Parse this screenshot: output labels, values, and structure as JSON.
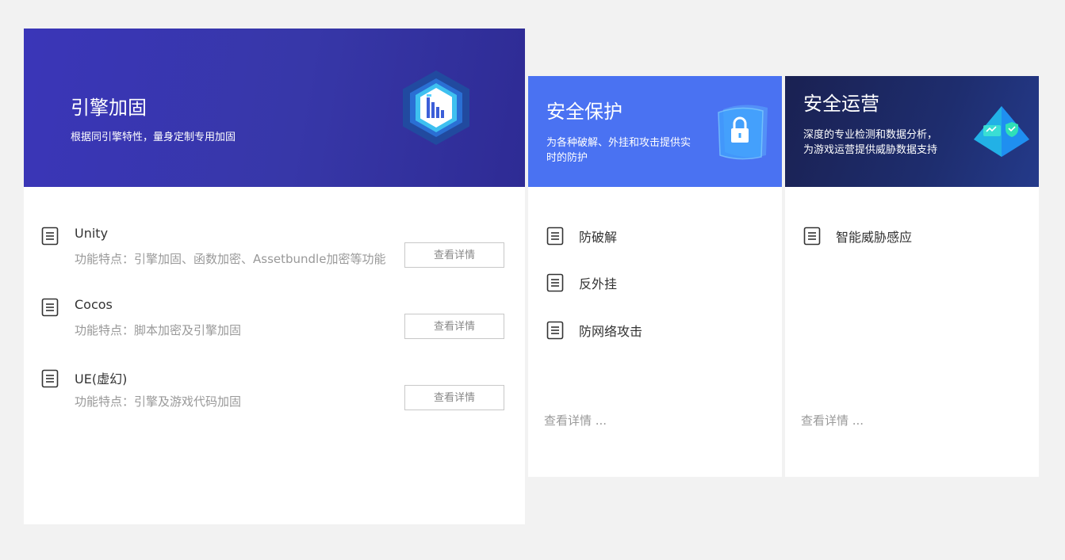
{
  "engine_card": {
    "title": "引擎加固",
    "description": "根据同引擎特性，量身定制专用加固",
    "items": [
      {
        "name": "Unity",
        "feature": "功能特点：引擎加固、函数加密、Assetbundle加密等功能",
        "button": "查看详情"
      },
      {
        "name": "Cocos",
        "feature": "功能特点：脚本加密及引擎加固",
        "button": "查看详情"
      },
      {
        "name": "UE(虚幻)",
        "feature": "功能特点：引擎及游戏代码加固",
        "button": "查看详情"
      }
    ],
    "icon": "hexagon-chart-icon"
  },
  "protect_card": {
    "title": "安全保护",
    "description": "为各种破解、外挂和攻击提供实时的防护",
    "items": [
      "防破解",
      "反外挂",
      "防网络攻击"
    ],
    "more": "查看详情 ...",
    "icon": "lock-icon"
  },
  "ops_card": {
    "title": "安全运营",
    "description": "深度的专业检测和数据分析，为游戏运营提供威胁数据支持",
    "items": [
      "智能威胁感应"
    ],
    "more": "查看详情 ...",
    "icon": "prism-shield-icon"
  },
  "colors": {
    "page_bg": "#f2f2f2",
    "engine_header": "#3a36b8",
    "protect_header": "#4a72f2",
    "ops_header": "#1e2d6e",
    "muted_text": "#999999"
  }
}
